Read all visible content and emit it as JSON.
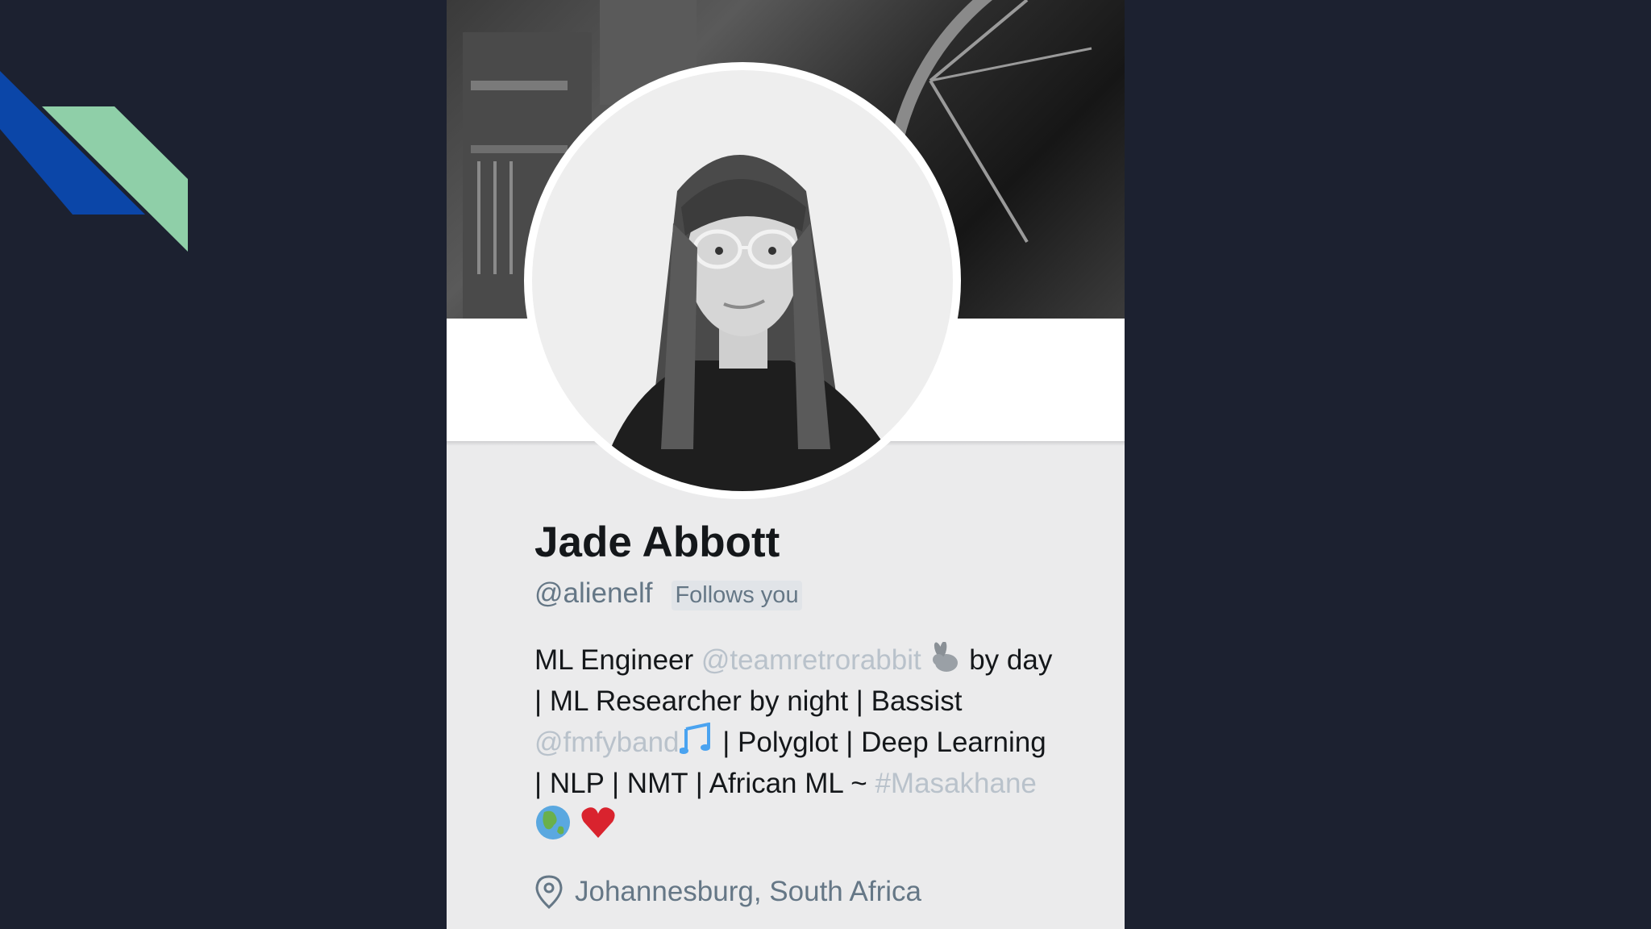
{
  "colors": {
    "background": "#1c2130",
    "deco_blue": "#0b46a8",
    "deco_green": "#8fcfa8",
    "card": "#ebebec",
    "name_text": "#14171a",
    "muted_text": "#657786",
    "link_text": "#b9c2cb"
  },
  "profile": {
    "name": "Jade Abbott",
    "handle": "@alienelf",
    "follows_badge": "Follows you",
    "bio": {
      "line1_a": "ML Engineer ",
      "line1_link": "@teamretrorabbit",
      "line1_b": " by day",
      "line2": "| ML Researcher by night | Bassist",
      "line3_link": "@fmfyband",
      "line3_b": " | Polyglot | Deep Learning",
      "line4_a": "| NLP | NMT | African ML ~ ",
      "line4_link": "#Masakhane",
      "emoji_rabbit": "rabbit-icon",
      "emoji_notes": "music-notes-icon",
      "emoji_globe": "globe-icon",
      "emoji_heart": "heart-icon"
    },
    "location": "Johannesburg, South Africa",
    "location_icon": "location-pin-icon"
  }
}
